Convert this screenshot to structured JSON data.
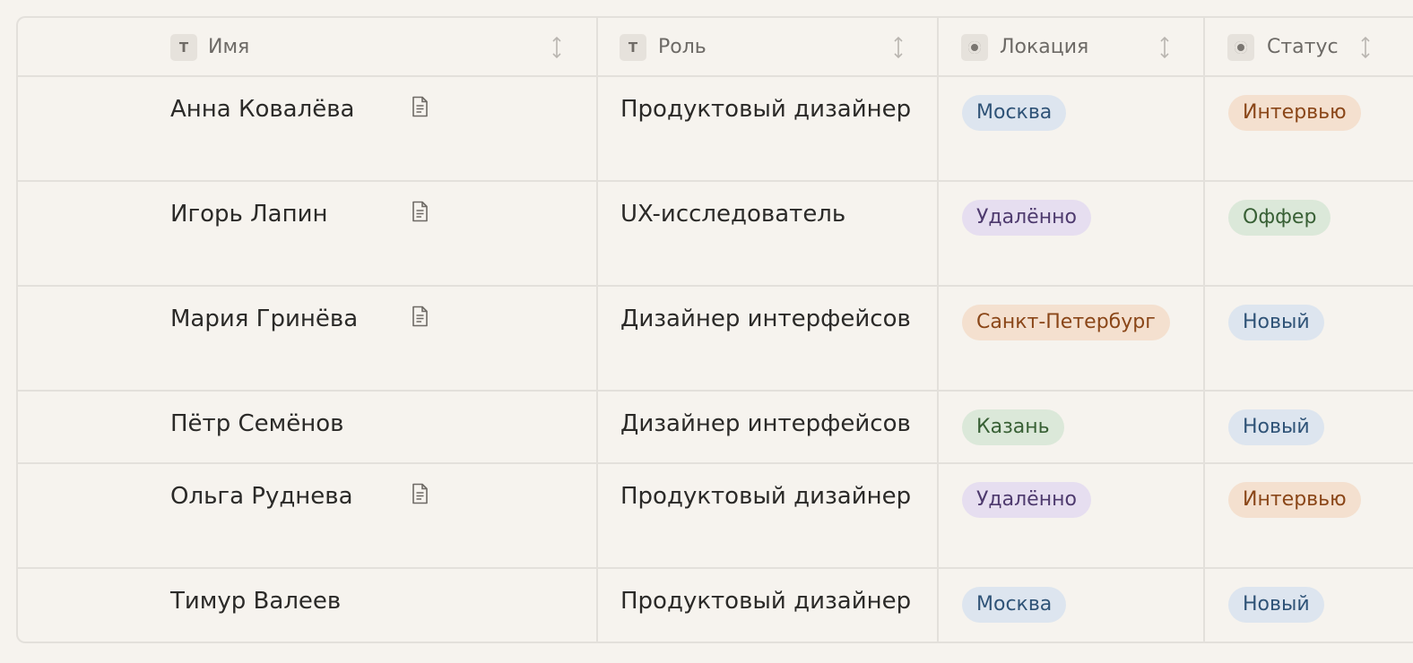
{
  "columns": [
    {
      "label": "Имя",
      "type_icon": "text-type-icon"
    },
    {
      "label": "Роль",
      "type_icon": "text-type-icon"
    },
    {
      "label": "Локация",
      "type_icon": "select-type-icon"
    },
    {
      "label": "Статус",
      "type_icon": "select-type-icon"
    }
  ],
  "type_glyph_text": "T",
  "rows": [
    {
      "name": "Анна Ковалёва",
      "has_doc": true,
      "role": "Продуктовый дизайнер",
      "location": {
        "label": "Москва",
        "color": "blue"
      },
      "status": {
        "label": "Интервью",
        "color": "orange"
      }
    },
    {
      "name": "Игорь Лапин",
      "has_doc": true,
      "role": "UX-исследователь",
      "location": {
        "label": "Удалённо",
        "color": "purple"
      },
      "status": {
        "label": "Оффер",
        "color": "green"
      }
    },
    {
      "name": "Мария Гринёва",
      "has_doc": true,
      "role": "Дизайнер интерфейсов",
      "location": {
        "label": "Санкт-Петербург",
        "color": "orange"
      },
      "status": {
        "label": "Новый",
        "color": "blue"
      }
    },
    {
      "name": "Пётр Семёнов",
      "has_doc": false,
      "role": "Дизайнер интерфейсов",
      "location": {
        "label": "Казань",
        "color": "green"
      },
      "status": {
        "label": "Новый",
        "color": "blue"
      }
    },
    {
      "name": "Ольга Руднева",
      "has_doc": true,
      "role": "Продуктовый дизайнер",
      "location": {
        "label": "Удалённо",
        "color": "purple"
      },
      "status": {
        "label": "Интервью",
        "color": "orange"
      }
    },
    {
      "name": "Тимур Валеев",
      "has_doc": false,
      "role": "Продуктовый дизайнер",
      "location": {
        "label": "Москва",
        "color": "blue"
      },
      "status": {
        "label": "Новый",
        "color": "blue"
      }
    }
  ],
  "colors": {
    "background": "#f6f3ee",
    "border": "#e3e0db",
    "pill_blue": "#dde5ef",
    "pill_purple": "#e6def0",
    "pill_orange": "#f4e0cf",
    "pill_green": "#dbe8d9"
  }
}
